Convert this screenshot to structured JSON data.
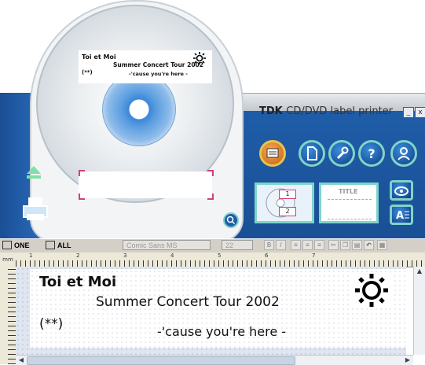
{
  "window": {
    "brand": "TDK",
    "subtitle": "CD/DVD label printer",
    "min_label": "_",
    "close_label": "x"
  },
  "disc": {
    "line1": "Toi et Moi",
    "line2": "Summer Concert Tour 2002",
    "line3": "(**)",
    "line4": "-'cause you're here -"
  },
  "panel": {
    "layout_title": "TITLE",
    "disc_layout_num1": "1",
    "disc_layout_num2": "2",
    "icons": [
      "eject-icon",
      "print-icon",
      "disc-design-icon",
      "new-document-icon",
      "settings-icon",
      "help-icon",
      "user-icon",
      "zoom-icon",
      "eye-icon",
      "text-style-icon"
    ]
  },
  "toolbar": {
    "one_label": "ONE",
    "all_label": "ALL",
    "font_name": "Comic Sans MS",
    "font_size": "22"
  },
  "editor": {
    "line1": "Toi et Moi",
    "line2": "Summer Concert Tour 2002",
    "line3": "(**)",
    "line4": "-'cause you're here -",
    "ruler_marks": [
      "1",
      "2",
      "3",
      "4",
      "5",
      "6",
      "7"
    ]
  },
  "colors": {
    "panel_blue": "#1a4f95",
    "accent_teal": "#7fd4c8",
    "marker_pink": "#d0407a"
  }
}
